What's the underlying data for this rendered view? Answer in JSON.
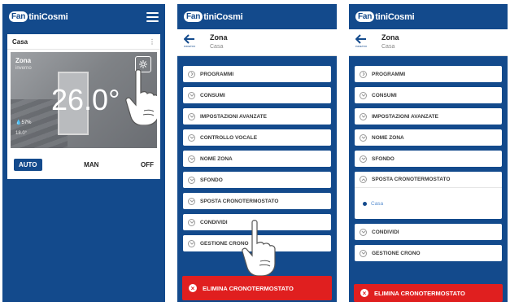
{
  "brand": {
    "logo_prefix": "Fan",
    "logo_text": "tiniCosmi"
  },
  "colors": {
    "primary": "#134a8c",
    "danger": "#e01f1f",
    "accent_link": "#5a8fd0"
  },
  "screen1": {
    "home_label": "Casa",
    "zone_name": "Zona",
    "zone_status": "inverno",
    "temperature": "26.0°",
    "humidity": "57%",
    "setpoint": "18.0°",
    "modes": [
      "AUTO",
      "MAN",
      "OFF"
    ],
    "active_mode": "AUTO",
    "icons": [
      "menu-icon",
      "settings-icon",
      "humidity-icon"
    ]
  },
  "screen2": {
    "title": "Zona",
    "subtitle": "Casa",
    "back_label": "INDIETRO",
    "menu": [
      "PROGRAMMI",
      "CONSUMI",
      "IMPOSTAZIONI AVANZATE",
      "CONTROLLO VOCALE",
      "NOME ZONA",
      "SFONDO",
      "SPOSTA CRONOTERMOSTATO",
      "CONDIVIDI",
      "GESTIONE CRONO"
    ],
    "delete_label": "ELIMINA CRONOTERMOSTATO"
  },
  "screen3": {
    "title": "Zona",
    "subtitle": "Casa",
    "back_label": "INDIETRO",
    "menu_before": [
      "PROGRAMMI",
      "CONSUMI",
      "IMPOSTAZIONI AVANZATE",
      "NOME ZONA",
      "SFONDO"
    ],
    "expanded_item": "SPOSTA CRONOTERMOSTATO",
    "expanded_option": "Casa",
    "menu_after": [
      "CONDIVIDI",
      "GESTIONE CRONO"
    ],
    "delete_label": "ELIMINA CRONOTERMOSTATO"
  }
}
